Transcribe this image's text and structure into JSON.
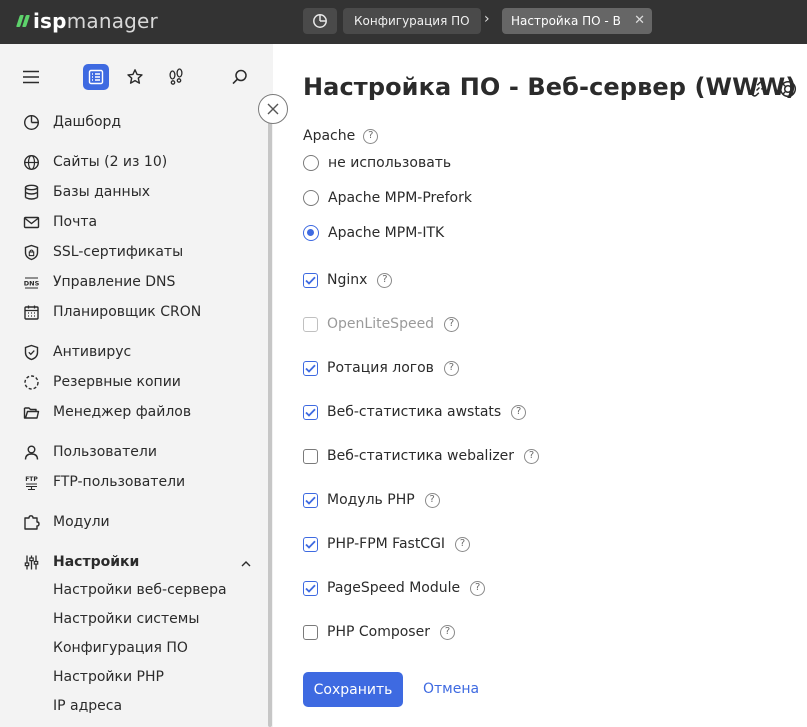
{
  "app": {
    "logo_isp": "isp",
    "logo_manager": "manager"
  },
  "breadcrumb": {
    "home_icon": "dashboard-icon",
    "items": [
      {
        "label": "Конфигурация ПО"
      }
    ],
    "separator": "›",
    "active": "Настройка ПО - Веб-сервер (WWW)",
    "close_icon": "close-icon"
  },
  "sidebar": {
    "tools": [
      "menu-icon",
      "list-icon",
      "star-icon",
      "footprints-icon",
      "search-icon"
    ],
    "collapse_icon": "close-icon",
    "items": [
      {
        "label": "Дашборд",
        "icon": "dashboard-icon"
      },
      {
        "label": "Сайты (2 из 10)",
        "icon": "globe-icon"
      },
      {
        "label": "Базы данных",
        "icon": "database-icon"
      },
      {
        "label": "Почта",
        "icon": "mail-icon"
      },
      {
        "label": "SSL-сертификаты",
        "icon": "lock-icon"
      },
      {
        "label": "Управление DNS",
        "icon": "dns-icon"
      },
      {
        "label": "Планировщик CRON",
        "icon": "calendar-icon"
      },
      {
        "label": "Антивирус",
        "icon": "shield-icon"
      },
      {
        "label": "Резервные копии",
        "icon": "backup-icon"
      },
      {
        "label": "Менеджер файлов",
        "icon": "folder-icon"
      },
      {
        "label": "Пользователи",
        "icon": "user-icon"
      },
      {
        "label": "FTP-пользователи",
        "icon": "ftp-icon"
      },
      {
        "label": "Модули",
        "icon": "modules-icon"
      },
      {
        "label": "Настройки",
        "icon": "sliders-icon"
      }
    ],
    "subitems": [
      {
        "label": "Настройки веб-сервера"
      },
      {
        "label": "Настройки системы"
      },
      {
        "label": "Конфигурация ПО"
      },
      {
        "label": "Настройки PHP"
      },
      {
        "label": "IP адреса"
      }
    ]
  },
  "main": {
    "title": "Настройка ПО - Веб-сервер (WWW)",
    "title_icons": [
      "link-icon",
      "help-lifebuoy-icon"
    ],
    "apache": {
      "label": "Apache",
      "help": "?",
      "options": [
        {
          "label": "не использовать",
          "selected": false
        },
        {
          "label": "Apache MPM-Prefork",
          "selected": false
        },
        {
          "label": "Apache MPM-ITK",
          "selected": true
        }
      ]
    },
    "checkboxes": [
      {
        "label": "Nginx",
        "checked": true,
        "disabled": false,
        "help": "?"
      },
      {
        "label": "OpenLiteSpeed",
        "checked": false,
        "disabled": true,
        "help": "?"
      },
      {
        "label": "Ротация логов",
        "checked": true,
        "disabled": false,
        "help": "?"
      },
      {
        "label": "Веб-статистика awstats",
        "checked": true,
        "disabled": false,
        "help": "?"
      },
      {
        "label": "Веб-статистика webalizer",
        "checked": false,
        "disabled": false,
        "help": "?"
      },
      {
        "label": "Модуль PHP",
        "checked": true,
        "disabled": false,
        "help": "?"
      },
      {
        "label": "PHP-FPM FastCGI",
        "checked": true,
        "disabled": false,
        "help": "?"
      },
      {
        "label": "PageSpeed Module",
        "checked": true,
        "disabled": false,
        "help": "?"
      },
      {
        "label": "PHP Composer",
        "checked": false,
        "disabled": false,
        "help": "?"
      }
    ],
    "save_label": "Сохранить",
    "cancel_label": "Отмена"
  },
  "colors": {
    "accent": "#3e6ae1",
    "topbar": "#333333",
    "sidebar": "#f3f3f3",
    "logo_green": "#5dd26b"
  }
}
